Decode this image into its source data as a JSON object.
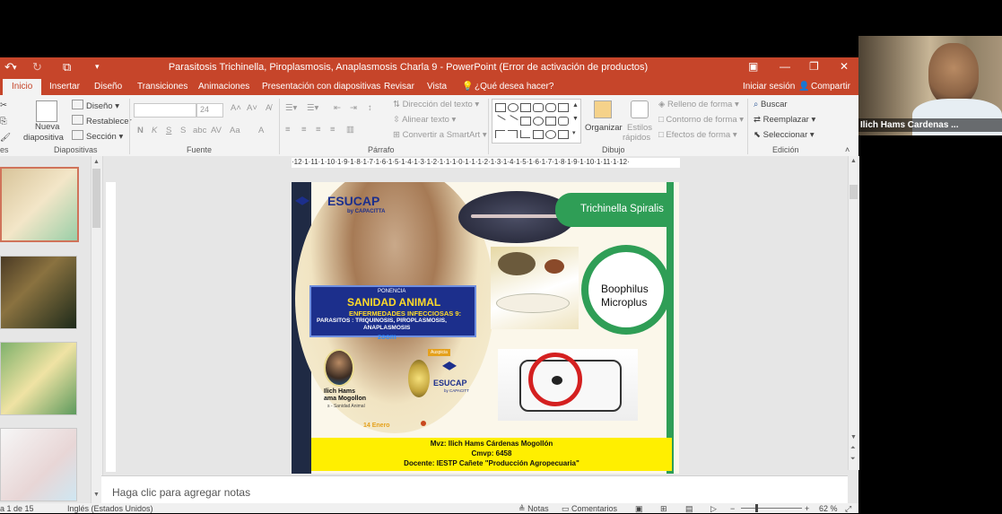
{
  "window": {
    "title": "Parasitosis Trichinella, Piroplasmosis, Anaplasmosis Charla 9 - PowerPoint (Error de activación de productos)"
  },
  "tabs": [
    {
      "label": "Inicio",
      "active": true
    },
    {
      "label": "Insertar"
    },
    {
      "label": "Diseño"
    },
    {
      "label": "Transiciones"
    },
    {
      "label": "Animaciones"
    },
    {
      "label": "Presentación con diapositivas"
    },
    {
      "label": "Revisar"
    },
    {
      "label": "Vista"
    }
  ],
  "tellme": "¿Qué desea hacer?",
  "signin": "Iniciar sesión",
  "share": "Compartir",
  "ribbon": {
    "diapositivas": {
      "nueva": "Nueva",
      "diapositiva": "diapositiva",
      "diseno": "Diseño",
      "restablecer": "Restablecer",
      "seccion": "Sección",
      "group": "Diapositivas"
    },
    "fuente": {
      "size": "24",
      "group": "Fuente",
      "bold": "N",
      "italic": "K",
      "underline": "S",
      "strike": "S",
      "case": "Aa"
    },
    "parrafo": {
      "direccion": "Dirección del texto",
      "alinear": "Alinear texto",
      "convertir": "Convertir a SmartArt",
      "group": "Párrafo"
    },
    "dibujo": {
      "organizar": "Organizar",
      "estilos1": "Estilos",
      "estilos2": "rápidos",
      "relleno": "Relleno de forma",
      "contorno": "Contorno de forma",
      "efectos": "Efectos de forma",
      "group": "Dibujo"
    },
    "edicion": {
      "buscar": "Buscar",
      "reemplazar": "Reemplazar",
      "seleccionar": "Seleccionar",
      "group": "Edición"
    }
  },
  "ruler": "·12·1·11·1·10·1·9·1·8·1·7·1·6·1·5·1·4·1·3·1·2·1·1·1·0·1·1·1·2·1·3·1·4·1·5·1·6·1·7·1·8·1·9·1·10·1·11·1·12·",
  "slide": {
    "logo": "ESUCAP",
    "logo_sub": "by CAPACITTA",
    "trichinella": "Trichinella Spiralis",
    "boophilus1": "Boophilus",
    "boophilus2": "Microplus",
    "ponencia": "PONENCIA",
    "sanidad": "SANIDAD ANIMAL",
    "enfermedades": "ENFERMEDADES INFECCIOSAS 9:",
    "parasitos": "PARASITOS : TRIQUINOSIS, PIROPLASMOSIS,",
    "parasitos2": "ANAPLASMOSIS",
    "zoom": "zoom",
    "speaker1": "Ilich Hams",
    "speaker2": "ama Mogollon",
    "speaker3": "s - Sanidad Animal",
    "date": "14 Enero",
    "auspicia": "Auspicia",
    "esucap2": "ESUCAP",
    "esucap2_sub": "by CAPACITT",
    "footer1": "Mvz: Ilich Hams Cárdenas Mogollón",
    "footer2": "Cmvp: 6458",
    "footer3": "Docente: IESTP Cañete \"Producción Agropecuaria\""
  },
  "notes_placeholder": "Haga clic para agregar notas",
  "status": {
    "slide": "a 1 de 15",
    "lang": "Inglés (Estados Unidos)",
    "notas": "Notas",
    "comentarios": "Comentarios",
    "zoom": "62 %"
  },
  "video": {
    "name": "Ilich Hams Cardenas ..."
  },
  "colors": {
    "accent": "#c6452a",
    "green": "#3fa05c",
    "yellow": "#ffef00",
    "navy": "#1c2f8c"
  }
}
